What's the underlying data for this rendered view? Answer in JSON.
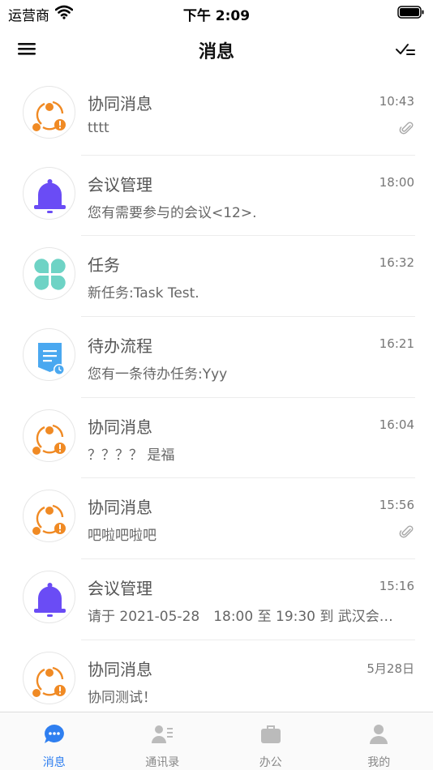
{
  "status_bar": {
    "carrier": "运营商",
    "time": "下午 2:09"
  },
  "header": {
    "title": "消息"
  },
  "messages": [
    {
      "title": "协同消息",
      "time": "10:43",
      "preview": "tttt",
      "icon": "collab-icon",
      "attachment": true
    },
    {
      "title": "会议管理",
      "time": "18:00",
      "preview": "您有需要参与的会议<12>.",
      "icon": "bell-icon",
      "attachment": false
    },
    {
      "title": "任务",
      "time": "16:32",
      "preview": "新任务:Task Test.",
      "icon": "clover-icon",
      "attachment": false
    },
    {
      "title": "待办流程",
      "time": "16:21",
      "preview": "您有一条待办任务:Yyy",
      "icon": "document-clock-icon",
      "attachment": false
    },
    {
      "title": "协同消息",
      "time": "16:04",
      "preview": "？？？？ 是福",
      "icon": "collab-icon",
      "attachment": false
    },
    {
      "title": "协同消息",
      "time": "15:56",
      "preview": "吧啦吧啦吧",
      "icon": "collab-icon",
      "attachment": true
    },
    {
      "title": "会议管理",
      "time": "15:16",
      "preview": "请于 2021-05-28　18:00 至 19:30 到 武汉会…",
      "icon": "bell-icon",
      "attachment": false
    },
    {
      "title": "协同消息",
      "time": "5月28日",
      "preview": "协同测试！",
      "icon": "collab-icon",
      "attachment": false
    }
  ],
  "tabs": [
    {
      "label": "消息",
      "icon": "chat-bubble-icon",
      "active": true
    },
    {
      "label": "通讯录",
      "icon": "contacts-icon",
      "active": false
    },
    {
      "label": "办公",
      "icon": "briefcase-icon",
      "active": false
    },
    {
      "label": "我的",
      "icon": "person-icon",
      "active": false
    }
  ],
  "colors": {
    "accent": "#2f7ff0",
    "collab_orange": "#f08a24",
    "meeting_purple": "#6a4cf5",
    "task_teal": "#6ed3c5",
    "todo_blue": "#4aa8f0"
  }
}
